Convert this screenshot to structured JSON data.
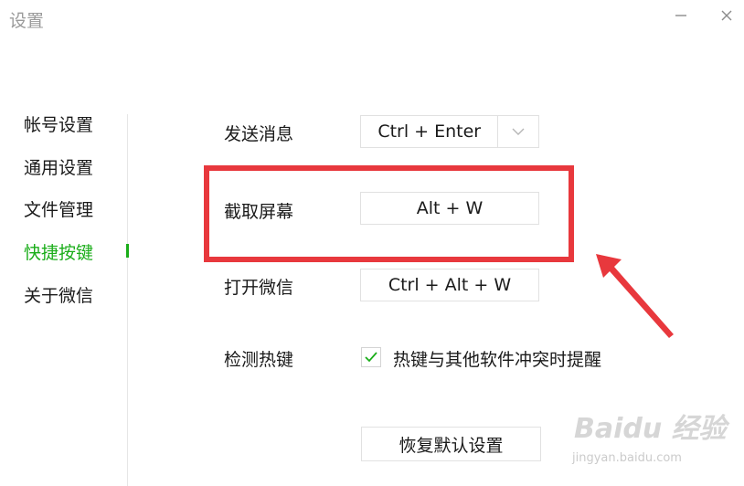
{
  "window": {
    "title": "设置"
  },
  "sidebar": {
    "items": [
      {
        "label": "帐号设置",
        "active": false
      },
      {
        "label": "通用设置",
        "active": false
      },
      {
        "label": "文件管理",
        "active": false
      },
      {
        "label": "快捷按键",
        "active": true
      },
      {
        "label": "关于微信",
        "active": false
      }
    ]
  },
  "shortcuts": {
    "send_message": {
      "label": "发送消息",
      "value": "Ctrl + Enter"
    },
    "screenshot": {
      "label": "截取屏幕",
      "value": "Alt + W"
    },
    "open_wechat": {
      "label": "打开微信",
      "value": "Ctrl + Alt + W"
    },
    "detect": {
      "label": "检测热键",
      "checkbox_label": "热键与其他软件冲突时提醒",
      "checked": true
    }
  },
  "reset_button": {
    "label": "恢复默认设置"
  },
  "watermark": {
    "brand": "Baidu 经验",
    "url": "jingyan.baidu.com"
  },
  "colors": {
    "accent": "#1aad19",
    "annotation": "#e8383d",
    "title_text": "#9a9a9a"
  },
  "icons": {
    "minimize": "minimize-icon",
    "close": "close-icon",
    "dropdown": "chevron-down-icon",
    "check": "check-icon"
  }
}
